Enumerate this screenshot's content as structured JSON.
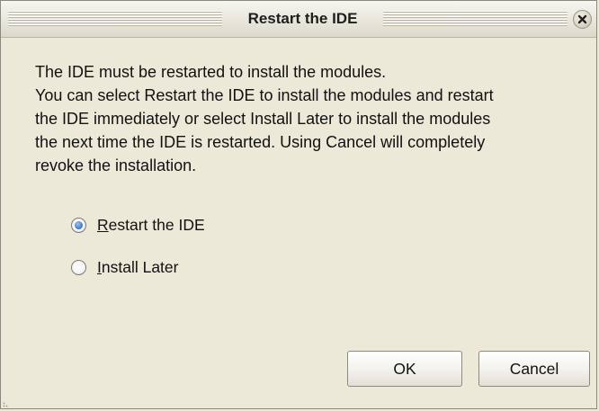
{
  "window": {
    "title": "Restart the IDE"
  },
  "message": {
    "lines": [
      "The IDE must be restarted to install the modules.",
      "You can select Restart the IDE to install the modules and restart",
      "the IDE immediately or select Install Later to install the modules",
      "the next time the IDE is restarted. Using Cancel will completely",
      "revoke the installation."
    ]
  },
  "options": [
    {
      "mnemonic": "R",
      "rest": "estart the IDE",
      "selected": true
    },
    {
      "mnemonic": "I",
      "rest": "nstall Later",
      "selected": false
    }
  ],
  "buttons": {
    "ok_label": "OK",
    "cancel_label": "Cancel"
  },
  "icons": {
    "close": "close-icon",
    "radio_selected_color": "#4a7fc7"
  }
}
